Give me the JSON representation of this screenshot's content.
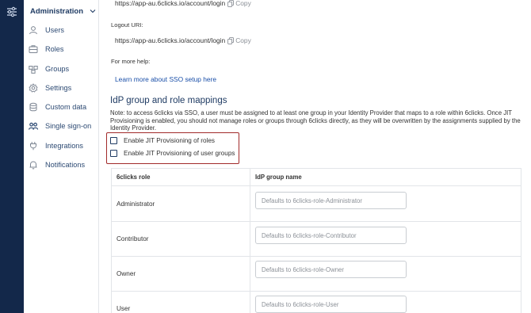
{
  "sidebar": {
    "section_label": "Administration",
    "items": [
      {
        "label": "Users",
        "icon": "user-icon"
      },
      {
        "label": "Roles",
        "icon": "roles-icon"
      },
      {
        "label": "Groups",
        "icon": "groups-icon"
      },
      {
        "label": "Settings",
        "icon": "gear-icon"
      },
      {
        "label": "Custom data",
        "icon": "database-icon"
      },
      {
        "label": "Single sign-on",
        "icon": "sso-icon"
      },
      {
        "label": "Integrations",
        "icon": "plug-icon"
      },
      {
        "label": "Notifications",
        "icon": "bell-icon"
      }
    ]
  },
  "sso": {
    "login_uri": "https://app-au.6clicks.io/account/login",
    "copy_label": "Copy",
    "logout_label": "Logout URI:",
    "logout_uri": "https://app-au.6clicks.io/account/login",
    "help_label": "For more help:",
    "help_link": "Learn more about SSO setup here"
  },
  "mappings": {
    "title": "IdP group and role mappings",
    "note": "Note: to access 6clicks via SSO, a user must be assigned to at least one group in your Identity Provider that maps to a role within 6clicks. Once JIT Provisioning is enabled, you should not manage roles or groups through 6clicks directly, as they will be overwritten by the assignments supplied by the Identity Provider.",
    "jit_roles": "Enable JIT Provisioning of roles",
    "jit_groups": "Enable JIT Provisioning of user groups",
    "col_role": "6clicks role",
    "col_group": "IdP group name",
    "rows": [
      {
        "role": "Administrator",
        "placeholder": "Defaults to 6clicks-role-Administrator"
      },
      {
        "role": "Contributor",
        "placeholder": "Defaults to 6clicks-role-Contributor"
      },
      {
        "role": "Owner",
        "placeholder": "Defaults to 6clicks-role-Owner"
      },
      {
        "role": "User",
        "placeholder": "Defaults to 6clicks-role-User"
      }
    ]
  },
  "colors": {
    "rail": "#13284a",
    "nav_text": "#2d4a73",
    "link": "#1a4fa8",
    "highlight_box": "#a12a2a"
  }
}
